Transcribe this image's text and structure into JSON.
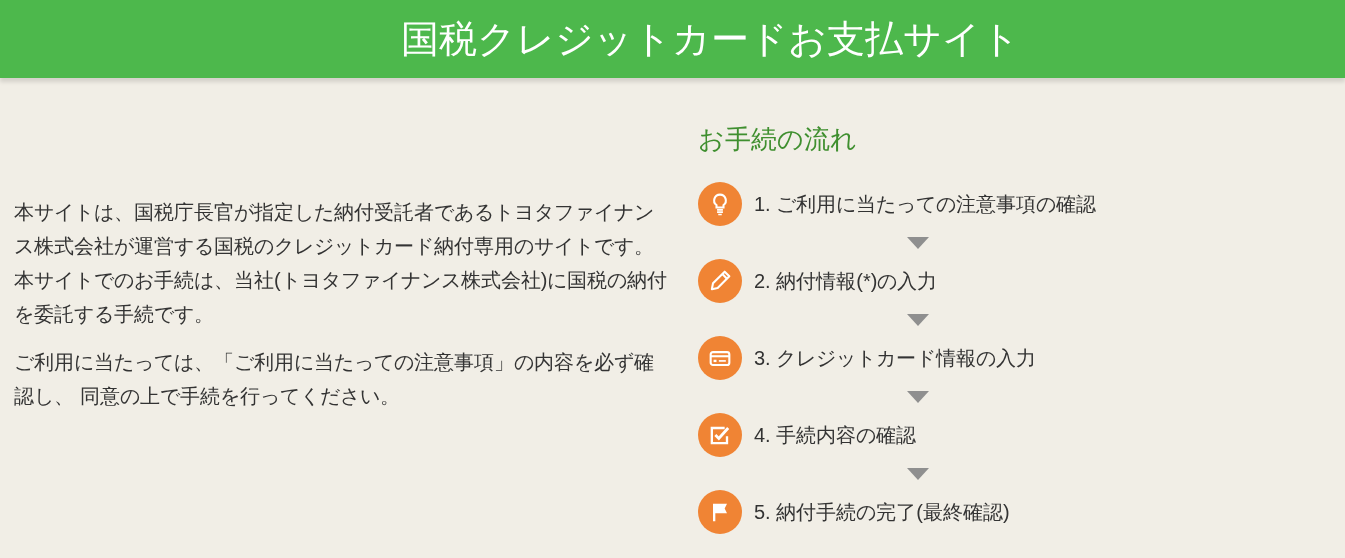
{
  "header": {
    "title": "国税クレジットカードお支払サイト"
  },
  "intro": [
    [
      "本サイトは、国税庁長官が指定した納付受託者であるトヨタファイナンス株式会社が運営する国税のクレジットカード納付専用のサイトです。",
      "本サイトでのお手続は、当社(トヨタファイナンス株式会社)に国税の納付を委託する手続です。"
    ],
    [
      "ご利用に当たっては、「ご利用に当たっての注意事項」の内容を必ず確認し、 同意の上で手続を行ってください。"
    ]
  ],
  "flow": {
    "heading": "お手続の流れ",
    "steps": [
      {
        "kind": "bulb",
        "label": "1. ご利用に当たっての注意事項の確認"
      },
      {
        "kind": "pencil",
        "label": "2. 納付情報(*)の入力"
      },
      {
        "kind": "card",
        "label": "3. クレジットカード情報の入力"
      },
      {
        "kind": "check",
        "label": "4. 手続内容の確認"
      },
      {
        "kind": "flag",
        "label": "5. 納付手続の完了(最終確認)"
      }
    ]
  }
}
